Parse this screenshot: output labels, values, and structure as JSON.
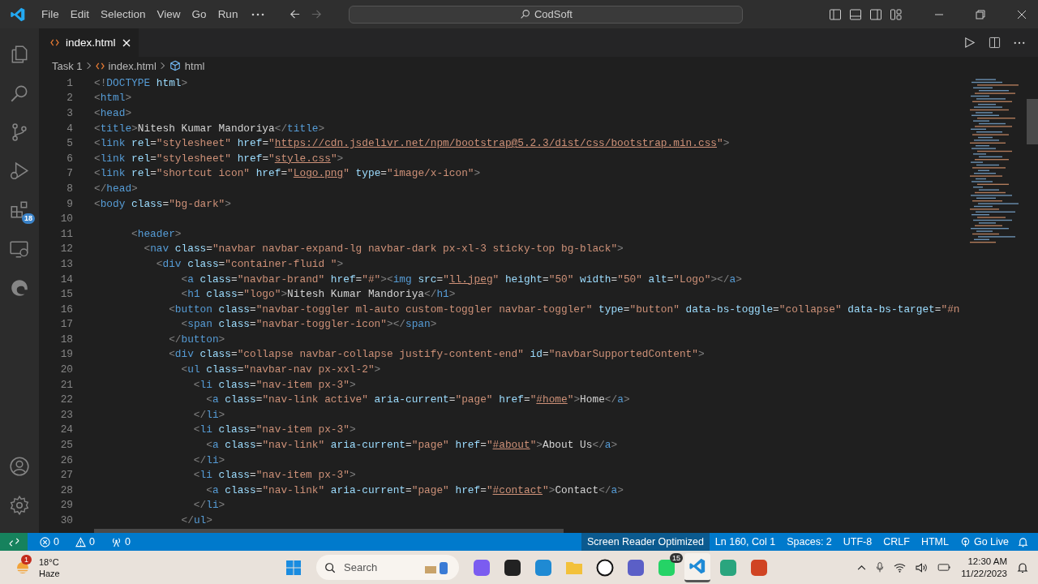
{
  "title_bar": {
    "menu": [
      "File",
      "Edit",
      "Selection",
      "View",
      "Go",
      "Run"
    ],
    "search": "CodSoft"
  },
  "activity_bar": {
    "top": [
      {
        "kind": "files"
      },
      {
        "kind": "search"
      },
      {
        "kind": "source-control"
      },
      {
        "kind": "run-debug"
      },
      {
        "kind": "extensions",
        "badge": "18"
      },
      {
        "kind": "remote"
      },
      {
        "kind": "edge"
      }
    ],
    "bottom": [
      {
        "kind": "account"
      },
      {
        "kind": "settings"
      }
    ]
  },
  "tabs": [
    {
      "label": "index.html",
      "selected": true
    }
  ],
  "breadcrumbs": [
    {
      "kind": "folder",
      "label": "Task 1"
    },
    {
      "kind": "file",
      "label": "index.html"
    },
    {
      "kind": "element",
      "label": "html"
    }
  ],
  "editor": {
    "lines": [
      {
        "number": "1",
        "tokens": [
          {
            "kind": "punct",
            "text": "<!"
          },
          {
            "kind": "tag",
            "text": "DOCTYPE"
          },
          {
            "kind": "attr",
            "text": " html"
          },
          {
            "kind": "punct",
            "text": ">"
          }
        ]
      },
      {
        "number": "2",
        "tokens": [
          {
            "kind": "punct",
            "text": "<"
          },
          {
            "kind": "tag",
            "text": "html"
          },
          {
            "kind": "punct",
            "text": ">"
          }
        ]
      },
      {
        "number": "3",
        "tokens": [
          {
            "kind": "punct",
            "text": "<"
          },
          {
            "kind": "tag",
            "text": "head"
          },
          {
            "kind": "punct",
            "text": ">"
          }
        ]
      },
      {
        "number": "4",
        "tokens": [
          {
            "kind": "punct",
            "text": "<"
          },
          {
            "kind": "tag",
            "text": "title"
          },
          {
            "kind": "punct",
            "text": ">"
          },
          {
            "kind": "text",
            "text": "Nitesh Kumar Mandoriya"
          },
          {
            "kind": "punct",
            "text": "</"
          },
          {
            "kind": "tag",
            "text": "title"
          },
          {
            "kind": "punct",
            "text": ">"
          }
        ]
      },
      {
        "number": "5",
        "tokens": [
          {
            "kind": "punct",
            "text": "<"
          },
          {
            "kind": "tag",
            "text": "link"
          },
          {
            "kind": "attr",
            "text": " rel"
          },
          {
            "kind": "text",
            "text": "="
          },
          {
            "kind": "string",
            "text": "\"stylesheet\""
          },
          {
            "kind": "attr",
            "text": " href"
          },
          {
            "kind": "text",
            "text": "="
          },
          {
            "kind": "string",
            "text": "\""
          },
          {
            "kind": "link",
            "text": "https://cdn.jsdelivr.net/npm/bootstrap@5.2.3/dist/css/bootstrap.min.css"
          },
          {
            "kind": "string",
            "text": "\""
          },
          {
            "kind": "punct",
            "text": ">"
          }
        ]
      },
      {
        "number": "6",
        "tokens": [
          {
            "kind": "punct",
            "text": "<"
          },
          {
            "kind": "tag",
            "text": "link"
          },
          {
            "kind": "attr",
            "text": " rel"
          },
          {
            "kind": "text",
            "text": "="
          },
          {
            "kind": "string",
            "text": "\"stylesheet\""
          },
          {
            "kind": "attr",
            "text": " href"
          },
          {
            "kind": "text",
            "text": "="
          },
          {
            "kind": "string",
            "text": "\""
          },
          {
            "kind": "link",
            "text": "style.css"
          },
          {
            "kind": "string",
            "text": "\""
          },
          {
            "kind": "punct",
            "text": ">"
          }
        ]
      },
      {
        "number": "7",
        "tokens": [
          {
            "kind": "punct",
            "text": "<"
          },
          {
            "kind": "tag",
            "text": "link"
          },
          {
            "kind": "attr",
            "text": " rel"
          },
          {
            "kind": "text",
            "text": "="
          },
          {
            "kind": "string",
            "text": "\"shortcut icon\""
          },
          {
            "kind": "attr",
            "text": " href"
          },
          {
            "kind": "text",
            "text": "="
          },
          {
            "kind": "string",
            "text": "\""
          },
          {
            "kind": "link",
            "text": "Logo.png"
          },
          {
            "kind": "string",
            "text": "\""
          },
          {
            "kind": "attr",
            "text": " type"
          },
          {
            "kind": "text",
            "text": "="
          },
          {
            "kind": "string",
            "text": "\"image/x-icon\""
          },
          {
            "kind": "punct",
            "text": ">"
          }
        ]
      },
      {
        "number": "8",
        "tokens": [
          {
            "kind": "punct",
            "text": "</"
          },
          {
            "kind": "tag",
            "text": "head"
          },
          {
            "kind": "punct",
            "text": ">"
          }
        ]
      },
      {
        "number": "9",
        "tokens": [
          {
            "kind": "punct",
            "text": "<"
          },
          {
            "kind": "tag",
            "text": "body"
          },
          {
            "kind": "attr",
            "text": " class"
          },
          {
            "kind": "text",
            "text": "="
          },
          {
            "kind": "string",
            "text": "\"bg-dark\""
          },
          {
            "kind": "punct",
            "text": ">"
          }
        ]
      },
      {
        "number": "10"
      },
      {
        "number": "11",
        "tokens": [
          {
            "kind": "punct",
            "text": "      <"
          },
          {
            "kind": "tag",
            "text": "header"
          },
          {
            "kind": "punct",
            "text": ">"
          }
        ]
      },
      {
        "number": "12",
        "tokens": [
          {
            "kind": "punct",
            "text": "        <"
          },
          {
            "kind": "tag",
            "text": "nav"
          },
          {
            "kind": "attr",
            "text": " class"
          },
          {
            "kind": "text",
            "text": "="
          },
          {
            "kind": "string",
            "text": "\"navbar navbar-expand-lg navbar-dark px-xl-3 sticky-top bg-black\""
          },
          {
            "kind": "punct",
            "text": ">"
          }
        ]
      },
      {
        "number": "13",
        "tokens": [
          {
            "kind": "punct",
            "text": "          <"
          },
          {
            "kind": "tag",
            "text": "div"
          },
          {
            "kind": "attr",
            "text": " class"
          },
          {
            "kind": "text",
            "text": "="
          },
          {
            "kind": "string",
            "text": "\"container-fluid \""
          },
          {
            "kind": "punct",
            "text": ">"
          }
        ]
      },
      {
        "number": "14",
        "tokens": [
          {
            "kind": "punct",
            "text": "              <"
          },
          {
            "kind": "tag",
            "text": "a"
          },
          {
            "kind": "attr",
            "text": " class"
          },
          {
            "kind": "text",
            "text": "="
          },
          {
            "kind": "string",
            "text": "\"navbar-brand\""
          },
          {
            "kind": "attr",
            "text": " href"
          },
          {
            "kind": "text",
            "text": "="
          },
          {
            "kind": "string",
            "text": "\"#\""
          },
          {
            "kind": "punct",
            "text": "><"
          },
          {
            "kind": "tag",
            "text": "img"
          },
          {
            "kind": "attr",
            "text": " src"
          },
          {
            "kind": "text",
            "text": "="
          },
          {
            "kind": "string",
            "text": "\""
          },
          {
            "kind": "link",
            "text": "ll.jpeg"
          },
          {
            "kind": "string",
            "text": "\""
          },
          {
            "kind": "attr",
            "text": " height"
          },
          {
            "kind": "text",
            "text": "="
          },
          {
            "kind": "string",
            "text": "\"50\""
          },
          {
            "kind": "attr",
            "text": " width"
          },
          {
            "kind": "text",
            "text": "="
          },
          {
            "kind": "string",
            "text": "\"50\""
          },
          {
            "kind": "attr",
            "text": " alt"
          },
          {
            "kind": "text",
            "text": "="
          },
          {
            "kind": "string",
            "text": "\"Logo\""
          },
          {
            "kind": "punct",
            "text": "></"
          },
          {
            "kind": "tag",
            "text": "a"
          },
          {
            "kind": "punct",
            "text": ">"
          }
        ]
      },
      {
        "number": "15",
        "tokens": [
          {
            "kind": "punct",
            "text": "              <"
          },
          {
            "kind": "tag",
            "text": "h1"
          },
          {
            "kind": "attr",
            "text": " class"
          },
          {
            "kind": "text",
            "text": "="
          },
          {
            "kind": "string",
            "text": "\"logo\""
          },
          {
            "kind": "punct",
            "text": ">"
          },
          {
            "kind": "text",
            "text": "Nitesh Kumar Mandoriya"
          },
          {
            "kind": "punct",
            "text": "</"
          },
          {
            "kind": "tag",
            "text": "h1"
          },
          {
            "kind": "punct",
            "text": ">"
          }
        ]
      },
      {
        "number": "16",
        "tokens": [
          {
            "kind": "punct",
            "text": "            <"
          },
          {
            "kind": "tag",
            "text": "button"
          },
          {
            "kind": "attr",
            "text": " class"
          },
          {
            "kind": "text",
            "text": "="
          },
          {
            "kind": "string",
            "text": "\"navbar-toggler ml-auto custom-toggler navbar-toggler\""
          },
          {
            "kind": "attr",
            "text": " type"
          },
          {
            "kind": "text",
            "text": "="
          },
          {
            "kind": "string",
            "text": "\"button\""
          },
          {
            "kind": "attr",
            "text": " data-bs-toggle"
          },
          {
            "kind": "text",
            "text": "="
          },
          {
            "kind": "string",
            "text": "\"collapse\""
          },
          {
            "kind": "attr",
            "text": " data-bs-target"
          },
          {
            "kind": "text",
            "text": "="
          },
          {
            "kind": "string",
            "text": "\"#n"
          }
        ]
      },
      {
        "number": "17",
        "tokens": [
          {
            "kind": "punct",
            "text": "              <"
          },
          {
            "kind": "tag",
            "text": "span"
          },
          {
            "kind": "attr",
            "text": " class"
          },
          {
            "kind": "text",
            "text": "="
          },
          {
            "kind": "string",
            "text": "\"navbar-toggler-icon\""
          },
          {
            "kind": "punct",
            "text": "></"
          },
          {
            "kind": "tag",
            "text": "span"
          },
          {
            "kind": "punct",
            "text": ">"
          }
        ]
      },
      {
        "number": "18",
        "tokens": [
          {
            "kind": "punct",
            "text": "            </"
          },
          {
            "kind": "tag",
            "text": "button"
          },
          {
            "kind": "punct",
            "text": ">"
          }
        ]
      },
      {
        "number": "19",
        "tokens": [
          {
            "kind": "punct",
            "text": "            <"
          },
          {
            "kind": "tag",
            "text": "div"
          },
          {
            "kind": "attr",
            "text": " class"
          },
          {
            "kind": "text",
            "text": "="
          },
          {
            "kind": "string",
            "text": "\"collapse navbar-collapse justify-content-end\""
          },
          {
            "kind": "attr",
            "text": " id"
          },
          {
            "kind": "text",
            "text": "="
          },
          {
            "kind": "string",
            "text": "\"navbarSupportedContent\""
          },
          {
            "kind": "punct",
            "text": ">"
          }
        ]
      },
      {
        "number": "20",
        "tokens": [
          {
            "kind": "punct",
            "text": "              <"
          },
          {
            "kind": "tag",
            "text": "ul"
          },
          {
            "kind": "attr",
            "text": " class"
          },
          {
            "kind": "text",
            "text": "="
          },
          {
            "kind": "string",
            "text": "\"navbar-nav px-xxl-2\""
          },
          {
            "kind": "punct",
            "text": ">"
          }
        ]
      },
      {
        "number": "21",
        "tokens": [
          {
            "kind": "punct",
            "text": "                <"
          },
          {
            "kind": "tag",
            "text": "li"
          },
          {
            "kind": "attr",
            "text": " class"
          },
          {
            "kind": "text",
            "text": "="
          },
          {
            "kind": "string",
            "text": "\"nav-item px-3\""
          },
          {
            "kind": "punct",
            "text": ">"
          }
        ]
      },
      {
        "number": "22",
        "tokens": [
          {
            "kind": "punct",
            "text": "                  <"
          },
          {
            "kind": "tag",
            "text": "a"
          },
          {
            "kind": "attr",
            "text": " class"
          },
          {
            "kind": "text",
            "text": "="
          },
          {
            "kind": "string",
            "text": "\"nav-link active\""
          },
          {
            "kind": "attr",
            "text": " aria-current"
          },
          {
            "kind": "text",
            "text": "="
          },
          {
            "kind": "string",
            "text": "\"page\""
          },
          {
            "kind": "attr",
            "text": " href"
          },
          {
            "kind": "text",
            "text": "="
          },
          {
            "kind": "string",
            "text": "\""
          },
          {
            "kind": "link",
            "text": "#home"
          },
          {
            "kind": "string",
            "text": "\""
          },
          {
            "kind": "punct",
            "text": ">"
          },
          {
            "kind": "text",
            "text": "Home"
          },
          {
            "kind": "punct",
            "text": "</"
          },
          {
            "kind": "tag",
            "text": "a"
          },
          {
            "kind": "punct",
            "text": ">"
          }
        ]
      },
      {
        "number": "23",
        "tokens": [
          {
            "kind": "punct",
            "text": "                </"
          },
          {
            "kind": "tag",
            "text": "li"
          },
          {
            "kind": "punct",
            "text": ">"
          }
        ]
      },
      {
        "number": "24",
        "tokens": [
          {
            "kind": "punct",
            "text": "                <"
          },
          {
            "kind": "tag",
            "text": "li"
          },
          {
            "kind": "attr",
            "text": " class"
          },
          {
            "kind": "text",
            "text": "="
          },
          {
            "kind": "string",
            "text": "\"nav-item px-3\""
          },
          {
            "kind": "punct",
            "text": ">"
          }
        ]
      },
      {
        "number": "25",
        "tokens": [
          {
            "kind": "punct",
            "text": "                  <"
          },
          {
            "kind": "tag",
            "text": "a"
          },
          {
            "kind": "attr",
            "text": " class"
          },
          {
            "kind": "text",
            "text": "="
          },
          {
            "kind": "string",
            "text": "\"nav-link\""
          },
          {
            "kind": "attr",
            "text": " aria-current"
          },
          {
            "kind": "text",
            "text": "="
          },
          {
            "kind": "string",
            "text": "\"page\""
          },
          {
            "kind": "attr",
            "text": " href"
          },
          {
            "kind": "text",
            "text": "="
          },
          {
            "kind": "string",
            "text": "\""
          },
          {
            "kind": "link",
            "text": "#about"
          },
          {
            "kind": "string",
            "text": "\""
          },
          {
            "kind": "punct",
            "text": ">"
          },
          {
            "kind": "text",
            "text": "About Us"
          },
          {
            "kind": "punct",
            "text": "</"
          },
          {
            "kind": "tag",
            "text": "a"
          },
          {
            "kind": "punct",
            "text": ">"
          }
        ]
      },
      {
        "number": "26",
        "tokens": [
          {
            "kind": "punct",
            "text": "                </"
          },
          {
            "kind": "tag",
            "text": "li"
          },
          {
            "kind": "punct",
            "text": ">"
          }
        ]
      },
      {
        "number": "27",
        "tokens": [
          {
            "kind": "punct",
            "text": "                <"
          },
          {
            "kind": "tag",
            "text": "li"
          },
          {
            "kind": "attr",
            "text": " class"
          },
          {
            "kind": "text",
            "text": "="
          },
          {
            "kind": "string",
            "text": "\"nav-item px-3\""
          },
          {
            "kind": "punct",
            "text": ">"
          }
        ]
      },
      {
        "number": "28",
        "tokens": [
          {
            "kind": "punct",
            "text": "                  <"
          },
          {
            "kind": "tag",
            "text": "a"
          },
          {
            "kind": "attr",
            "text": " class"
          },
          {
            "kind": "text",
            "text": "="
          },
          {
            "kind": "string",
            "text": "\"nav-link\""
          },
          {
            "kind": "attr",
            "text": " aria-current"
          },
          {
            "kind": "text",
            "text": "="
          },
          {
            "kind": "string",
            "text": "\"page\""
          },
          {
            "kind": "attr",
            "text": " href"
          },
          {
            "kind": "text",
            "text": "="
          },
          {
            "kind": "string",
            "text": "\""
          },
          {
            "kind": "link",
            "text": "#contact"
          },
          {
            "kind": "string",
            "text": "\""
          },
          {
            "kind": "punct",
            "text": ">"
          },
          {
            "kind": "text",
            "text": "Contact"
          },
          {
            "kind": "punct",
            "text": "</"
          },
          {
            "kind": "tag",
            "text": "a"
          },
          {
            "kind": "punct",
            "text": ">"
          }
        ]
      },
      {
        "number": "29",
        "tokens": [
          {
            "kind": "punct",
            "text": "                </"
          },
          {
            "kind": "tag",
            "text": "li"
          },
          {
            "kind": "punct",
            "text": ">"
          }
        ]
      },
      {
        "number": "30",
        "tokens": [
          {
            "kind": "punct",
            "text": "              </"
          },
          {
            "kind": "tag",
            "text": "ul"
          },
          {
            "kind": "punct",
            "text": ">"
          }
        ]
      }
    ]
  },
  "status_bar": {
    "problems": [
      {
        "kind": "error",
        "count": "0"
      },
      {
        "kind": "warning",
        "count": "0"
      },
      {
        "kind": "ports",
        "count": "0"
      }
    ],
    "items": [
      {
        "label": "Screen Reader Optimized",
        "highlighted": true
      },
      {
        "label": "Ln 160, Col 1",
        "highlighted": false
      },
      {
        "label": "Spaces: 2",
        "highlighted": false
      },
      {
        "label": "UTF-8",
        "highlighted": false
      },
      {
        "label": "CRLF",
        "highlighted": false
      },
      {
        "label": "HTML",
        "highlighted": false
      }
    ],
    "go_live": "Go Live"
  },
  "taskbar": {
    "weather": {
      "badge": "1",
      "temperature": "18°C",
      "condition": "Haze"
    },
    "search_placeholder": "Search",
    "apps": [
      {
        "kind": "copilot",
        "active": false
      },
      {
        "kind": "task-view",
        "active": false
      },
      {
        "kind": "edge",
        "active": false
      },
      {
        "kind": "folder",
        "active": false
      },
      {
        "kind": "dell",
        "active": false
      },
      {
        "kind": "teams",
        "active": false
      },
      {
        "kind": "chat",
        "active": false,
        "badge": "15"
      },
      {
        "kind": "vscode",
        "active": true
      },
      {
        "kind": "chatgpt",
        "active": false
      },
      {
        "kind": "powerpoint",
        "active": false
      }
    ],
    "time": "12:30 AM",
    "date": "11/22/2023"
  }
}
